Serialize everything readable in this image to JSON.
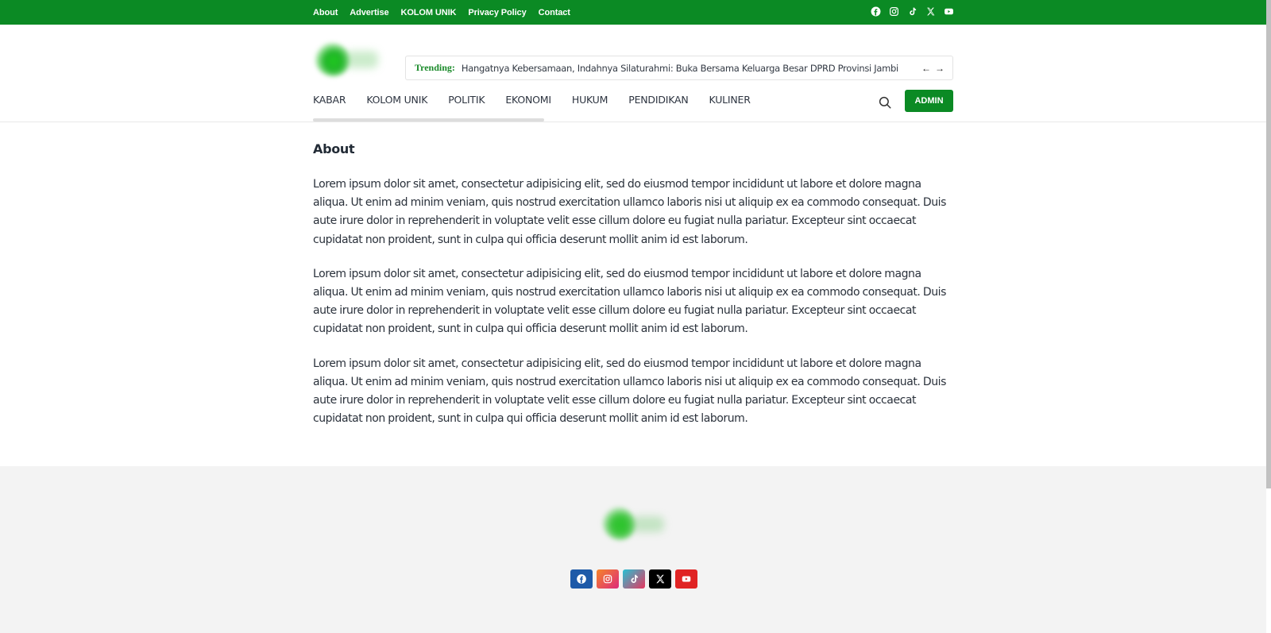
{
  "topbar": {
    "links": [
      "About",
      "Advertise",
      "KOLOM UNIK",
      "Privacy Policy",
      "Contact"
    ],
    "social": [
      "facebook-icon",
      "instagram-icon",
      "tiktok-icon",
      "x-icon",
      "youtube-icon"
    ],
    "bg_color": "#0b8a24"
  },
  "trending": {
    "label": "Trending:",
    "headline": "Hangatnya Kebersamaan, Indahnya Silaturahmi: Buka Bersama Keluarga Besar DPRD Provinsi Jambi",
    "prev_arrow": "←",
    "next_arrow": "→"
  },
  "nav": {
    "items": [
      "KABAR",
      "KOLOM UNIK",
      "POLITIK",
      "EKONOMI",
      "HUKUM",
      "PENDIDIKAN",
      "KULINER"
    ],
    "admin_label": "ADMIN"
  },
  "page": {
    "title": "About",
    "paragraphs": [
      "Lorem ipsum dolor sit amet, consectetur adipisicing elit, sed do eiusmod tempor incididunt ut labore et dolore magna aliqua. Ut enim ad minim veniam, quis nostrud exercitation ullamco laboris nisi ut aliquip ex ea commodo consequat. Duis aute irure dolor in reprehenderit in voluptate velit esse cillum dolore eu fugiat nulla pariatur. Excepteur sint occaecat cupidatat non proident, sunt in culpa qui officia deserunt mollit anim id est laborum.",
      "Lorem ipsum dolor sit amet, consectetur adipisicing elit, sed do eiusmod tempor incididunt ut labore et dolore magna aliqua. Ut enim ad minim veniam, quis nostrud exercitation ullamco laboris nisi ut aliquip ex ea commodo consequat. Duis aute irure dolor in reprehenderit in voluptate velit esse cillum dolore eu fugiat nulla pariatur. Excepteur sint occaecat cupidatat non proident, sunt in culpa qui officia deserunt mollit anim id est laborum.",
      "Lorem ipsum dolor sit amet, consectetur adipisicing elit, sed do eiusmod tempor incididunt ut labore et dolore magna aliqua. Ut enim ad minim veniam, quis nostrud exercitation ullamco laboris nisi ut aliquip ex ea commodo consequat. Duis aute irure dolor in reprehenderit in voluptate velit esse cillum dolore eu fugiat nulla pariatur. Excepteur sint occaecat cupidatat non proident, sunt in culpa qui officia deserunt mollit anim id est laborum."
    ]
  },
  "footer": {
    "social": [
      {
        "icon": "facebook-icon",
        "color": "#1e5aa8"
      },
      {
        "icon": "instagram-icon",
        "color": "#e8564a"
      },
      {
        "icon": "tiktok-icon",
        "color": "#d9356d"
      },
      {
        "icon": "x-icon",
        "color": "#000000"
      },
      {
        "icon": "youtube-icon",
        "color": "#e02424"
      }
    ]
  }
}
